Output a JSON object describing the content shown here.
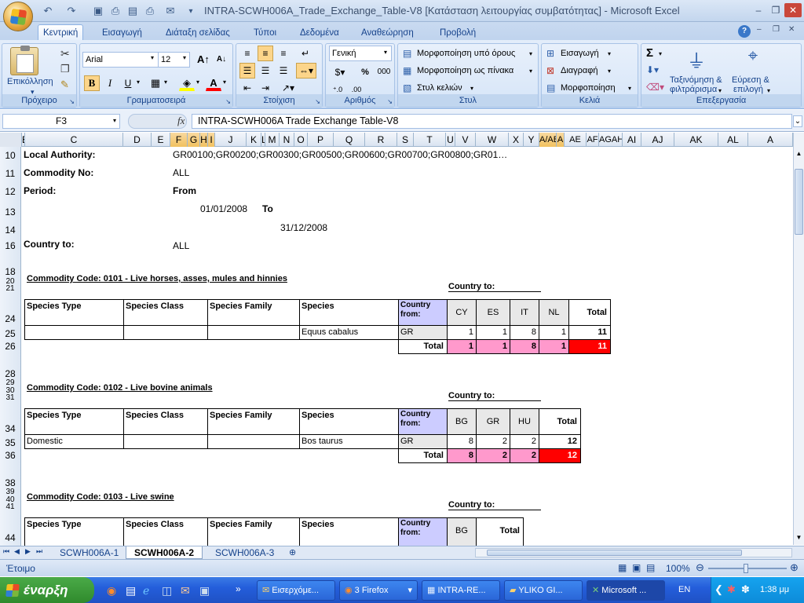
{
  "window": {
    "title": "INTRA-SCWH006A_Trade_Exchange_Table-V8  [Κατάσταση λειτουργίας συμβατότητας] - Microsoft Excel",
    "minimize": "–",
    "restore": "❐",
    "close": "✕"
  },
  "ribbon_tabs": [
    "Κεντρική",
    "Εισαγωγή",
    "Διάταξη σελίδας",
    "Τύποι",
    "Δεδομένα",
    "Αναθεώρηση",
    "Προβολή"
  ],
  "ribbon": {
    "clipboard": {
      "paste": "Επικόλληση",
      "label": "Πρόχειρο"
    },
    "font": {
      "name": "Arial",
      "size": "12",
      "bold": "B",
      "italic": "I",
      "underline": "U",
      "label": "Γραμματοσειρά"
    },
    "alignment": {
      "label": "Στοίχιση"
    },
    "number": {
      "format": "Γενική",
      "percent": "%",
      "thousands": "000",
      "label": "Αριθμός"
    },
    "styles": {
      "conditional": "Μορφοποίηση υπό όρους",
      "table": "Μορφοποίηση ως πίνακα",
      "cell": "Στυλ κελιών",
      "label": "Στυλ"
    },
    "cells": {
      "insert": "Εισαγωγή",
      "delete": "Διαγραφή",
      "format": "Μορφοποίηση",
      "label": "Κελιά"
    },
    "editing": {
      "sum": "Σ",
      "sort1": "Ταξινόμηση &",
      "sort2": "φιλτράρισμα",
      "find1": "Εύρεση &",
      "find2": "επιλογή",
      "label": "Επεξεργασία"
    }
  },
  "formula_bar": {
    "name_box": "F3",
    "fx": "fx",
    "formula": "INTRA-SCWH006A Trade Exchange Table-V8"
  },
  "columns": [
    "B",
    "C",
    "D",
    "E",
    "F",
    "G",
    "H",
    "I",
    "J",
    "K",
    "L",
    "M",
    "N",
    "O",
    "P",
    "Q",
    "R",
    "S",
    "T",
    "U",
    "V",
    "W",
    "X",
    "Y",
    "Z",
    "AA",
    "AB",
    "AC",
    "AD",
    "AE",
    "AF",
    "AG",
    "AH",
    "AI",
    "AJ",
    "AK",
    "AL",
    "AM"
  ],
  "columns_display": {
    "Y": "Y",
    "AAAB": "A/AB",
    "AC": "A",
    "AD": "AE",
    "AF": "AF",
    "AGAH": "AGAH",
    "AI": "AI",
    "AJ": "AJ",
    "AK": "AK",
    "AL": "AL",
    "AM": "A"
  },
  "rows": [
    "10",
    "11",
    "12",
    "13",
    "14",
    "16",
    "18",
    "20",
    "21",
    "24",
    "25",
    "26",
    "28",
    "29",
    "30",
    "31",
    "34",
    "35",
    "36",
    "38",
    "39",
    "40",
    "41",
    "44"
  ],
  "sheet": {
    "local_authority_label": "Local Authority:",
    "local_authority_value": "GR00100;GR00200;GR00300;GR00500;GR00600;GR00700;GR00800;GR01…",
    "commodity_no_label": "Commodity No:",
    "commodity_no_value": "ALL",
    "period_label": "Period:",
    "period_from": "From",
    "date_from": "01/01/2008",
    "to": "To",
    "date_to": "31/12/2008",
    "country_to_label": "Country to:",
    "country_to_value": "ALL"
  },
  "tables": [
    {
      "title": "Commodity Code: 0101 - Live horses, asses, mules and hinnies",
      "country_to": "Country to:",
      "headers": [
        "Species Type",
        "Species Class",
        "Species Family",
        "Species"
      ],
      "country_from": "Country from:",
      "countries": [
        "CY",
        "ES",
        "IT",
        "NL"
      ],
      "total_label": "Total",
      "row": {
        "type": "",
        "class": "",
        "family": "",
        "species": "Equus cabalus",
        "from": "GR",
        "values": [
          "1",
          "1",
          "8",
          "1"
        ],
        "total": "11"
      },
      "totals": {
        "label": "Total",
        "values": [
          "1",
          "1",
          "8",
          "1"
        ],
        "total": "11"
      }
    },
    {
      "title": "Commodity Code: 0102 - Live bovine animals",
      "country_to": "Country to:",
      "headers": [
        "Species Type",
        "Species Class",
        "Species Family",
        "Species"
      ],
      "country_from": "Country from:",
      "countries": [
        "BG",
        "GR",
        "HU"
      ],
      "total_label": "Total",
      "row": {
        "type": "Domestic",
        "class": "",
        "family": "",
        "species": "Bos taurus",
        "from": "GR",
        "values": [
          "8",
          "2",
          "2"
        ],
        "total": "12"
      },
      "totals": {
        "label": "Total",
        "values": [
          "8",
          "2",
          "2"
        ],
        "total": "12"
      }
    },
    {
      "title": "Commodity Code: 0103 - Live swine",
      "country_to": "Country to:",
      "headers": [
        "Species Type",
        "Species Class",
        "Species Family",
        "Species"
      ],
      "country_from": "Country from:",
      "countries": [
        "BG"
      ],
      "total_label": "Total"
    }
  ],
  "sheet_tabs": [
    "SCWH006A-1",
    "SCWH006A-2",
    "SCWH006A-3"
  ],
  "status": {
    "ready": "Έτοιμο",
    "zoom": "100%"
  },
  "taskbar": {
    "start": "έναρξη",
    "tasks": [
      "Εισερχόμε...",
      "3 Firefox",
      "INTRA-RE...",
      "YLIKO GI...",
      "Microsoft ..."
    ],
    "lang": "EN",
    "clock": "1:38 μμ"
  }
}
